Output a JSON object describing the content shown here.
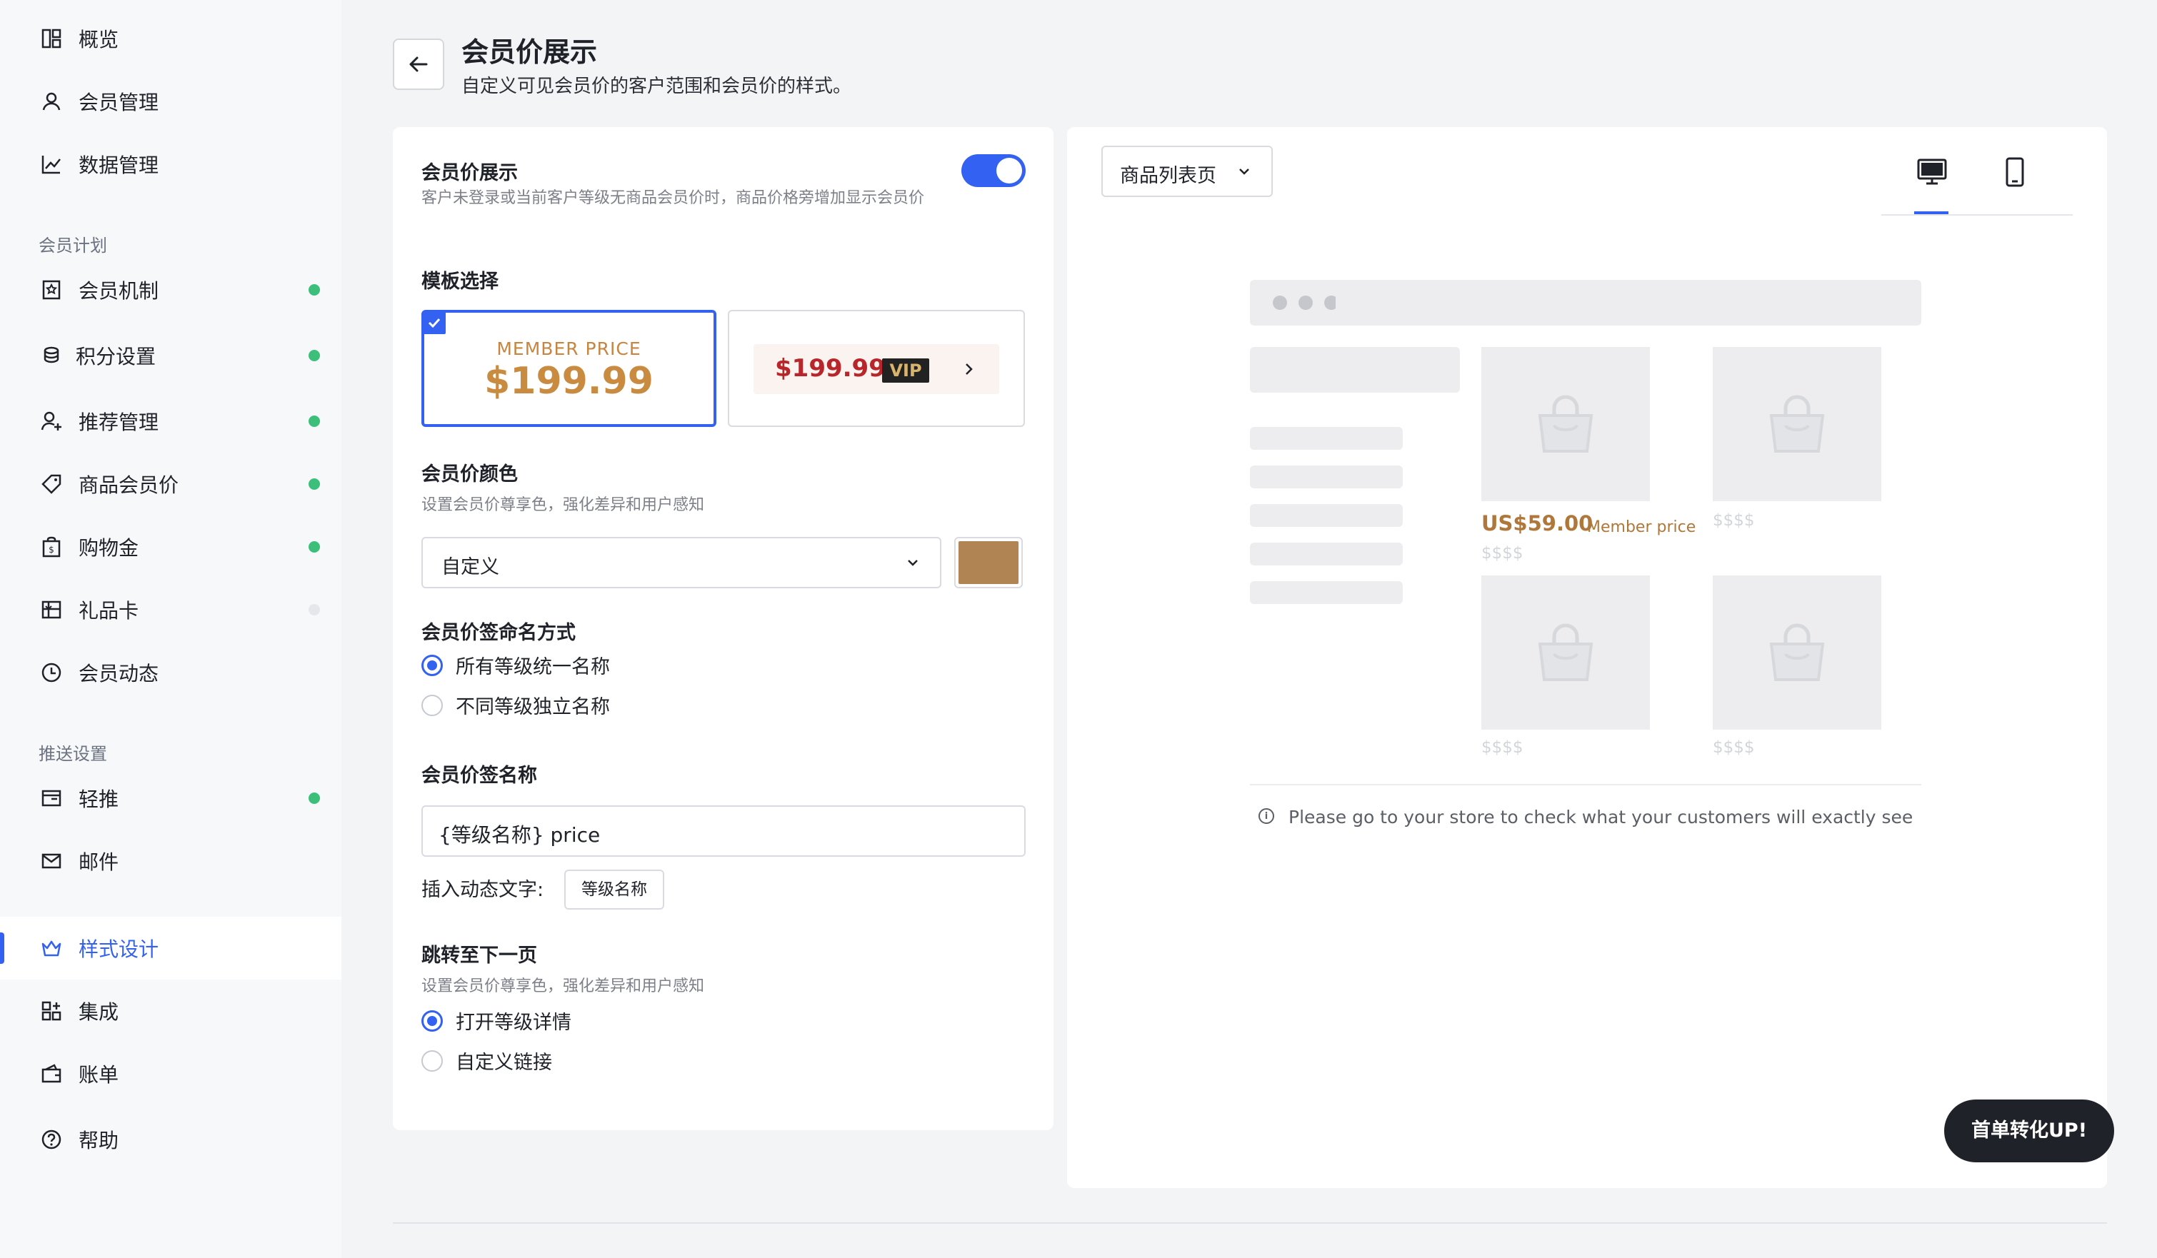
{
  "sidebar": {
    "top_items": [
      {
        "label": "概览",
        "icon": "dashboard-icon"
      },
      {
        "label": "会员管理",
        "icon": "user-icon"
      },
      {
        "label": "数据管理",
        "icon": "chart-line-icon"
      }
    ],
    "section_plan": "会员计划",
    "plan_items": [
      {
        "label": "会员机制",
        "icon": "badge-icon",
        "status": "on"
      },
      {
        "label": "积分设置",
        "icon": "coins-icon",
        "status": "on"
      },
      {
        "label": "推荐管理",
        "icon": "user-plus-icon",
        "status": "on"
      },
      {
        "label": "商品会员价",
        "icon": "tag-icon",
        "status": "on"
      },
      {
        "label": "购物金",
        "icon": "wallet-bag-icon",
        "status": "on"
      },
      {
        "label": "礼品卡",
        "icon": "gift-card-icon",
        "status": "off"
      },
      {
        "label": "会员动态",
        "icon": "clock-icon"
      }
    ],
    "section_push": "推送设置",
    "push_items": [
      {
        "label": "轻推",
        "icon": "popup-icon",
        "status": "on"
      },
      {
        "label": "邮件",
        "icon": "mail-icon"
      }
    ],
    "bottom_items": [
      {
        "label": "样式设计",
        "icon": "crown-icon",
        "active": true
      },
      {
        "label": "集成",
        "icon": "apps-icon"
      },
      {
        "label": "账单",
        "icon": "wallet-icon"
      },
      {
        "label": "帮助",
        "icon": "help-icon"
      }
    ]
  },
  "header": {
    "title": "会员价展示",
    "subtitle": "自定义可见会员价的客户范围和会员价的样式。"
  },
  "settings": {
    "display_title": "会员价展示",
    "display_desc": "客户未登录或当前客户等级无商品会员价时，商品价格旁增加显示会员价",
    "display_enabled": true,
    "template_title": "模板选择",
    "template1_label": "MEMBER PRICE",
    "template1_price": "$199.99",
    "template2_price": "$199.99",
    "template2_tag": "VIP",
    "color_title": "会员价颜色",
    "color_desc": "设置会员价尊享色，强化差异和用户感知",
    "color_select": "自定义",
    "color_value": "#b08453",
    "naming_title": "会员价签命名方式",
    "naming_options": [
      "所有等级统一名称",
      "不同等级独立名称"
    ],
    "naming_selected": 0,
    "tagname_title": "会员价签名称",
    "tagname_value": "{等级名称} price",
    "insert_label": "插入动态文字:",
    "insert_chip": "等级名称",
    "jump_title": "跳转至下一页",
    "jump_desc": "设置会员价尊享色，强化差异和用户感知",
    "jump_options": [
      "打开等级详情",
      "自定义链接"
    ],
    "jump_selected": 0
  },
  "preview": {
    "page_select": "商品列表页",
    "devices": [
      "desktop-icon",
      "mobile-icon"
    ],
    "active_device": "desktop",
    "member_price": "US$59.00",
    "member_price_label": "Member price",
    "placeholder_price": "$$$$",
    "notice": "Please go to your store to check what your customers will exactly see"
  },
  "promo": {
    "label": "首单转化UP!"
  }
}
